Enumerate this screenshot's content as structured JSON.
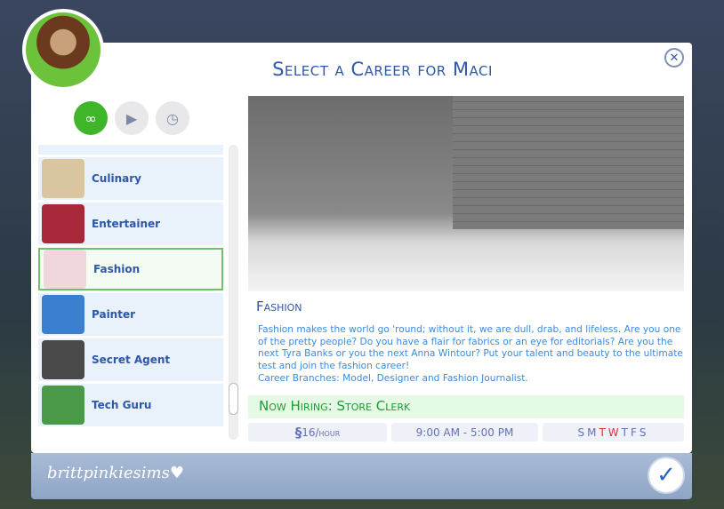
{
  "title": "Select a Career for Maci",
  "filters": [
    {
      "icon": "infinity-icon",
      "active": true
    },
    {
      "icon": "briefcase-play-icon"
    },
    {
      "icon": "briefcase-clock-icon"
    }
  ],
  "careers": [
    "Culinary",
    "Entertainer",
    "Fashion",
    "Painter",
    "Secret Agent",
    "Tech Guru"
  ],
  "selected": "Fashion",
  "detail": {
    "name": "Fashion",
    "description": "Fashion makes the world go 'round; without it, we are dull, drab, and lifeless. Are you one of the pretty people? Do you have a flair for fabrics or an eye for editorials?  Are you the next Tyra Banks or you the next Anna Wintour? Put your talent and beauty to the ultimate test and join the fashion career!",
    "branches": "Career Branches: Model, Designer and Fashion Journalist.",
    "hiring": "Now Hiring: Store Clerk",
    "pay_symbol": "§",
    "pay": "16/hour",
    "hours": "9:00  AM - 5:00  PM",
    "days": [
      "S",
      "M",
      "T",
      "W",
      "T",
      "F",
      "S"
    ],
    "workdays_color": "#e0303a"
  },
  "footer": {
    "watermark": "brittpinkiesims♥"
  }
}
